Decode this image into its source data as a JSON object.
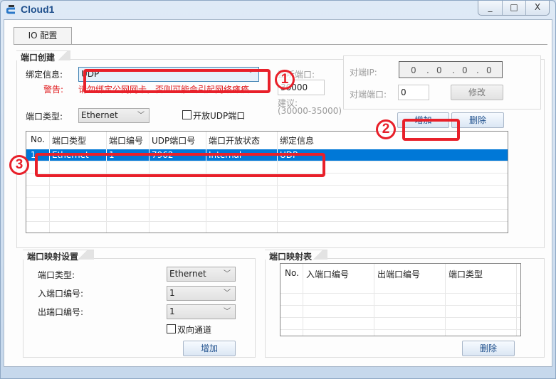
{
  "window": {
    "title": "Cloud1",
    "controls": {
      "minimize": "_",
      "maximize": "□",
      "close": "X"
    }
  },
  "tabs": [
    {
      "label": "IO 配置",
      "active": true
    }
  ],
  "port_create": {
    "group_label": "端口创建",
    "bind_label": "绑定信息:",
    "bind_value": "UDP",
    "warning_label": "警告:",
    "warning_text": "请勿绑定公网网卡，否则可能会引起网络瘫痪。",
    "listen_port_label": "监听端口:",
    "listen_port_value": "30000",
    "suggest_label": "建议:",
    "suggest_range": "(30000-35000)",
    "port_type_label": "端口类型:",
    "port_type_value": "Ethernet",
    "open_udp_label": "开放UDP端口",
    "open_udp_checked": false,
    "peer_ip_label": "对端IP:",
    "peer_ip_value": [
      "0",
      "0",
      "0",
      "0"
    ],
    "peer_port_label": "对端端口:",
    "peer_port_value": "0",
    "modify_button": "修改",
    "add_button": "增加",
    "delete_button": "删除",
    "table": {
      "columns": [
        "No.",
        "端口类型",
        "端口编号",
        "UDP端口号",
        "端口开放状态",
        "绑定信息"
      ],
      "rows": [
        [
          "1",
          "Ethernet",
          "1",
          "7962",
          "Internal",
          "UDP"
        ]
      ],
      "selected_row": 0
    }
  },
  "port_mapping_settings": {
    "group_label": "端口映射设置",
    "port_type_label": "端口类型:",
    "port_type_value": "Ethernet",
    "in_port_label": "入端口编号:",
    "in_port_value": "1",
    "out_port_label": "出端口编号:",
    "out_port_value": "1",
    "bidirectional_label": "双向通道",
    "bidirectional_checked": false,
    "add_button": "增加"
  },
  "port_mapping_table": {
    "group_label": "端口映射表",
    "columns": [
      "No.",
      "入端口编号",
      "出端口编号",
      "端口类型"
    ],
    "rows": [],
    "delete_button": "删除"
  },
  "annotations": [
    {
      "number": "1",
      "target": "bind-select"
    },
    {
      "number": "2",
      "target": "add-button"
    },
    {
      "number": "3",
      "target": "table-row"
    }
  ],
  "colors": {
    "accent": "#0078d7",
    "annotation": "#e8202a",
    "warning": "#e0191b",
    "title": "#1e4f8c"
  }
}
